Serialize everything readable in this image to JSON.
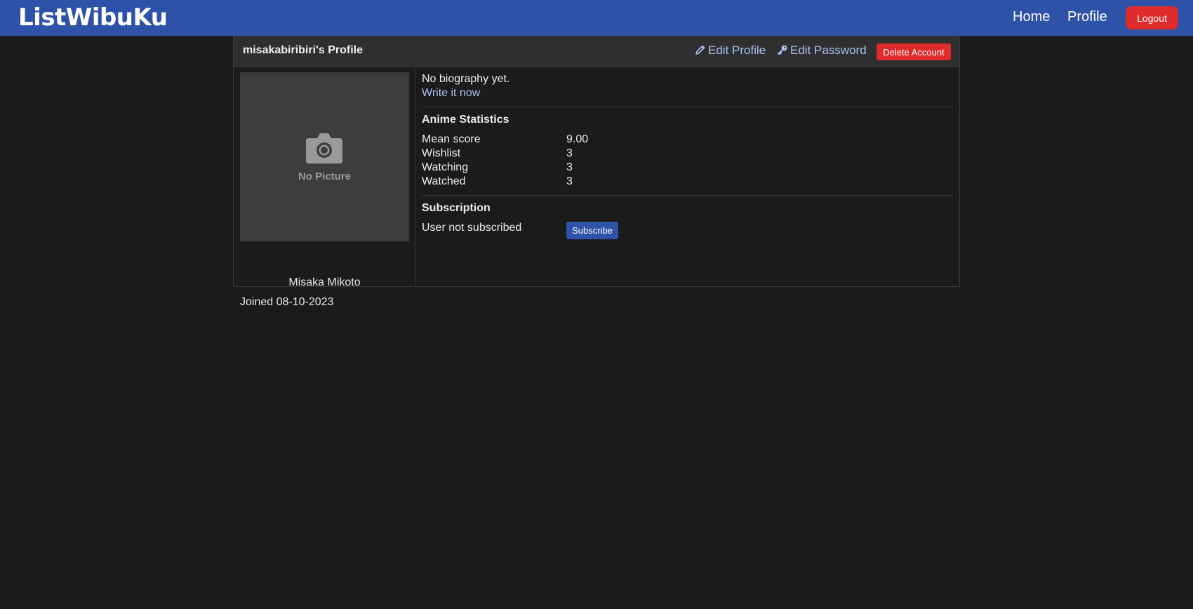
{
  "navbar": {
    "brand": "ListWibuKu",
    "links": [
      "Home",
      "Profile"
    ],
    "logout_label": "Logout"
  },
  "profile": {
    "title": "misakabiribiri's Profile",
    "edit_profile_label": "Edit Profile",
    "edit_password_label": "Edit Password",
    "delete_label": "Delete Account",
    "no_picture_label": "No Picture",
    "display_name": "Misaka Mikoto",
    "joined": "Joined 08-10-2023",
    "bio": "No biography yet.",
    "bio_link": "Write it now"
  },
  "stats": {
    "title": "Anime Statistics",
    "rows": [
      {
        "label": "Mean score",
        "value": "9.00"
      },
      {
        "label": "Wishlist",
        "value": "3"
      },
      {
        "label": "Watching",
        "value": "3"
      },
      {
        "label": "Watched",
        "value": "3"
      }
    ]
  },
  "subscription": {
    "title": "Subscription",
    "status": "User not subscribed",
    "button_label": "Subscribe"
  },
  "colors": {
    "navbar": "#2e52a7",
    "danger": "#de2b2b",
    "link": "#a9c2f2",
    "background": "#1b1b1b"
  },
  "icons": [
    "camera-icon",
    "pencil-icon",
    "key-icon"
  ]
}
